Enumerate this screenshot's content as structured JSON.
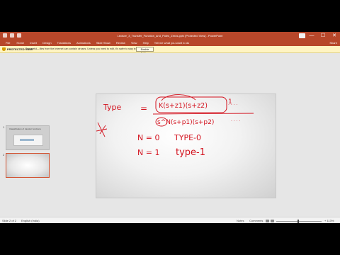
{
  "window": {
    "title": "Lecture_3_Transfer_Function_and_Poles_Zeros.pptx [Protected View] - PowerPoint",
    "controls": [
      "—",
      "☐",
      "✕"
    ]
  },
  "ribbon": {
    "tabs": [
      "File",
      "Home",
      "Insert",
      "Design",
      "Transitions",
      "Animations",
      "Slide Show",
      "Review",
      "View",
      "Help",
      "Tell me what you want to do"
    ],
    "share": "Share"
  },
  "protected_view": {
    "label": "PROTECTED VIEW",
    "message": "Be careful—files from the Internet can contain viruses. Unless you need to edit, it's safer to stay in Protected View.",
    "button": "Enable Editing"
  },
  "slide_pane": {
    "thumbnails": [
      {
        "number": "1",
        "title": "Classification of transfer functions"
      },
      {
        "number": "2",
        "title": ""
      }
    ],
    "selected": 2
  },
  "slide": {
    "ink": {
      "line1_left": "Type",
      "line1_eq": "=",
      "line1_expr": "K(s+z1)(s+z2)",
      "line1_dots": "· · · ·",
      "line1_note": "1",
      "line2_expr": "s^N(s+p1)(s+p2)",
      "line2_dots": "· · · ·",
      "line3_left": "N = 0",
      "line3_right": "TYPE-0",
      "line4_left": "N = 1",
      "line4_right": "type-1"
    }
  },
  "status": {
    "slide_info": "Slide 2 of 2",
    "language": "English (India)",
    "notes": "Notes",
    "comments": "Comments",
    "zoom": "+ 113%"
  },
  "colors": {
    "accent": "#b7472a",
    "ink": "#d3121e",
    "warning_bar": "#fff4c2"
  }
}
